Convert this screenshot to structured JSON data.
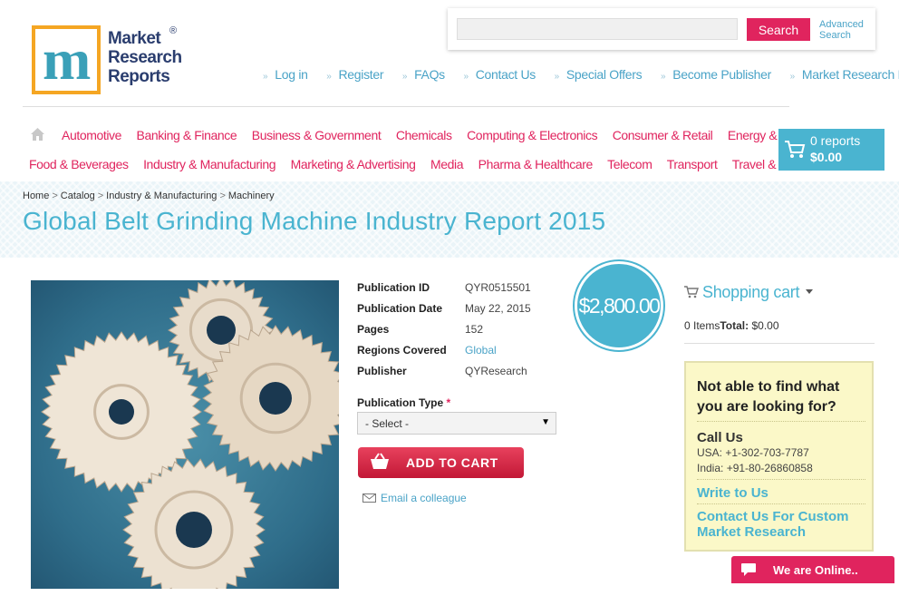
{
  "logo": {
    "line1": "Market",
    "line2": "Research",
    "line3": "Reports",
    "reg": "®"
  },
  "search": {
    "placeholder": "",
    "button": "Search",
    "advanced_line1": "Advanced",
    "advanced_line2": "Search"
  },
  "toplinks": [
    "Log in",
    "Register",
    "FAQs",
    "Contact Us",
    "Special Offers",
    "Become Publisher",
    "Market Research Blog"
  ],
  "categories_row1": [
    "Automotive",
    "Banking & Finance",
    "Business & Government",
    "Chemicals",
    "Computing & Electronics",
    "Consumer & Retail",
    "Energy & Utilities"
  ],
  "categories_row2": [
    "Food & Beverages",
    "Industry & Manufacturing",
    "Marketing & Advertising",
    "Media",
    "Pharma & Healthcare",
    "Telecom",
    "Transport",
    "Travel & Leisure"
  ],
  "header_cart": {
    "reports": "0 reports",
    "total": "$0.00"
  },
  "breadcrumb": [
    "Home",
    "Catalog",
    "Industry & Manufacturing",
    "Machinery"
  ],
  "page_title": "Global Belt Grinding Machine Industry Report 2015",
  "details": [
    {
      "label": "Publication ID",
      "value": "QYR0515501"
    },
    {
      "label": "Publication Date",
      "value": "May 22, 2015"
    },
    {
      "label": "Pages",
      "value": "152"
    },
    {
      "label": "Regions Covered",
      "value": "Global"
    },
    {
      "label": "Publisher",
      "value": "QYResearch"
    }
  ],
  "price": "$2,800.00",
  "publication_type": {
    "label": "Publication Type",
    "required": "*",
    "selected": "- Select -"
  },
  "add_to_cart": "ADD TO CART",
  "email_colleague": "Email a colleague",
  "shopping_cart": {
    "title": "Shopping cart",
    "items": "0 Items",
    "total_label": "Total:",
    "total_value": "$0.00"
  },
  "help": {
    "title": "Not able to find what you are looking for?",
    "call_title": "Call Us",
    "usa": "USA: +1-302-703-7787",
    "india": "India: +91-80-26860858",
    "write": "Write to Us",
    "custom": "Contact Us For Custom Market Research"
  },
  "chat": "We are Online..",
  "colors": {
    "accent_pink": "#e0245e",
    "accent_blue": "#4ab4d0",
    "link_blue": "#4aa3c7",
    "help_bg": "#fbf8c8"
  }
}
